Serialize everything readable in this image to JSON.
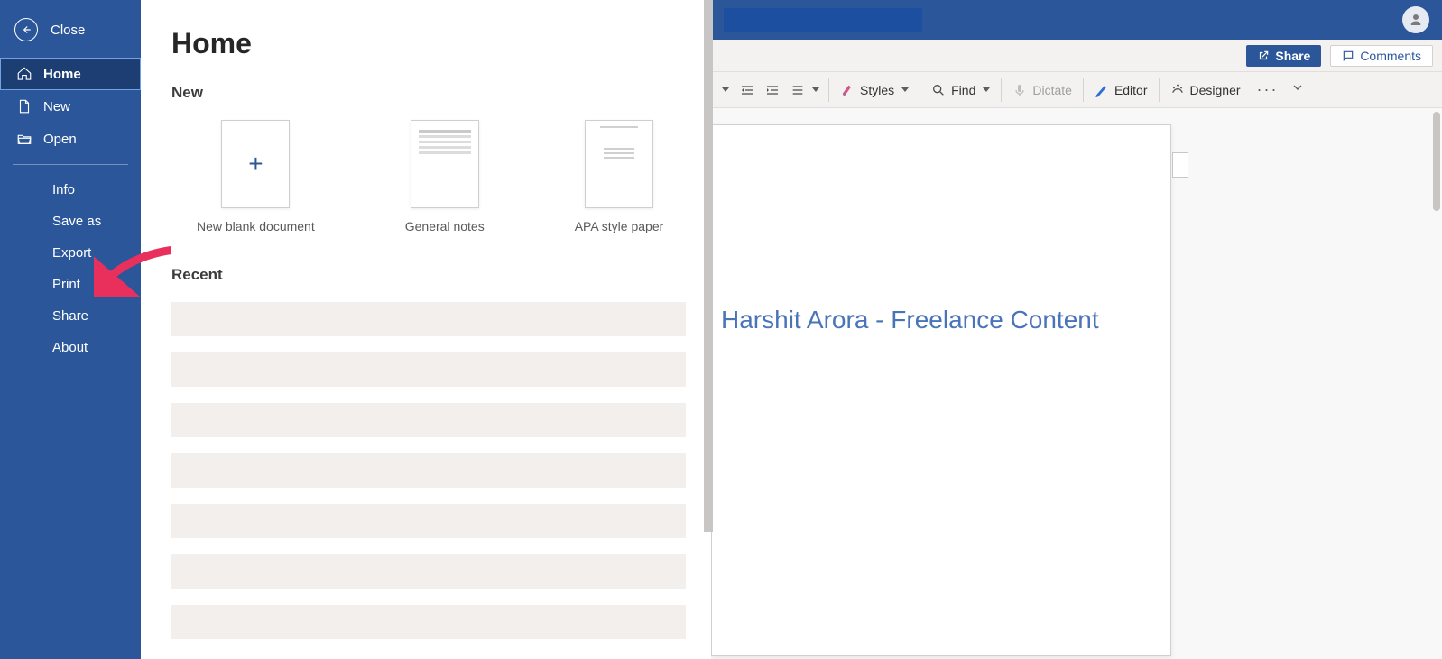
{
  "sidebar": {
    "close": "Close",
    "nav_top": [
      {
        "label": "Home",
        "icon": "home-icon",
        "selected": true
      },
      {
        "label": "New",
        "icon": "new-file-icon"
      },
      {
        "label": "Open",
        "icon": "open-folder-icon"
      }
    ],
    "nav_bottom": [
      {
        "label": "Info"
      },
      {
        "label": "Save as"
      },
      {
        "label": "Export"
      },
      {
        "label": "Print"
      },
      {
        "label": "Share"
      },
      {
        "label": "About"
      }
    ]
  },
  "backstage": {
    "title": "Home",
    "new_header": "New",
    "recent_header": "Recent",
    "templates": [
      {
        "label": "New blank document",
        "kind": "blank"
      },
      {
        "label": "General notes",
        "kind": "notes"
      },
      {
        "label": "APA style paper",
        "kind": "apa"
      }
    ]
  },
  "annotation": {
    "type": "arrow",
    "target": "Print",
    "color": "#e9305d"
  },
  "doc": {
    "toolbar": {
      "share": "Share",
      "comments": "Comments"
    },
    "ribbon": {
      "styles": "Styles",
      "find": "Find",
      "dictate": "Dictate",
      "editor": "Editor",
      "designer": "Designer"
    },
    "page": {
      "link_text": "Harshit Arora - Freelance Content"
    }
  }
}
